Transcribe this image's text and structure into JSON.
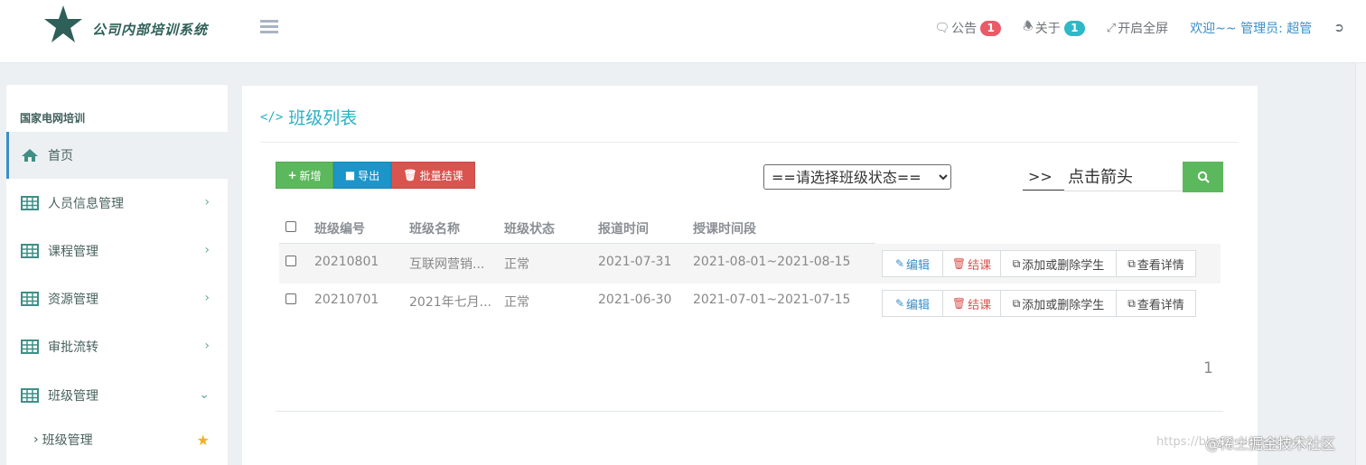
{
  "header": {
    "brand": "公司内部培训系统",
    "notice": {
      "label": "公告",
      "count": "1"
    },
    "about": {
      "label": "关于",
      "count": "1"
    },
    "fullscreen": "开启全屏",
    "welcome": "欢迎~~ 管理员: 超管"
  },
  "sidebar": {
    "title": "国家电网培训",
    "items": [
      {
        "label": "首页"
      },
      {
        "label": "人员信息管理"
      },
      {
        "label": "课程管理"
      },
      {
        "label": "资源管理"
      },
      {
        "label": "审批流转"
      },
      {
        "label": "班级管理"
      }
    ],
    "sub_item": "班级管理"
  },
  "main": {
    "title": "班级列表",
    "toolbar": {
      "add": "新增",
      "export": "导出",
      "batch_close": "批量结课"
    },
    "status_select": {
      "selected": "==请选择班级状态=="
    },
    "search": {
      "prefix": ">>",
      "value": "点击箭头"
    },
    "table": {
      "headers": [
        "班级编号",
        "班级名称",
        "班级状态",
        "报道时间",
        "授课时间段"
      ],
      "rows": [
        {
          "id": "20210801",
          "name": "互联网营销...",
          "status": "正常",
          "report": "2021-07-31",
          "period": "2021-08-01~2021-08-15"
        },
        {
          "id": "20210701",
          "name": "2021年七月...",
          "status": "正常",
          "report": "2021-06-30",
          "period": "2021-07-01~2021-07-15"
        }
      ],
      "actions": {
        "edit": "编辑",
        "close": "结课",
        "manage": "添加或删除学生",
        "view": "查看详情"
      }
    },
    "pagination": {
      "current": "1"
    }
  },
  "watermark": {
    "url": "https://blog.csdn.net/m0_",
    "text": "@稀土掘金技术社区"
  },
  "colors": {
    "accent": "#2ab0c5",
    "success": "#5cb85c",
    "primary": "#1c95c9",
    "danger": "#d9534f",
    "link": "#3a8fc9"
  }
}
